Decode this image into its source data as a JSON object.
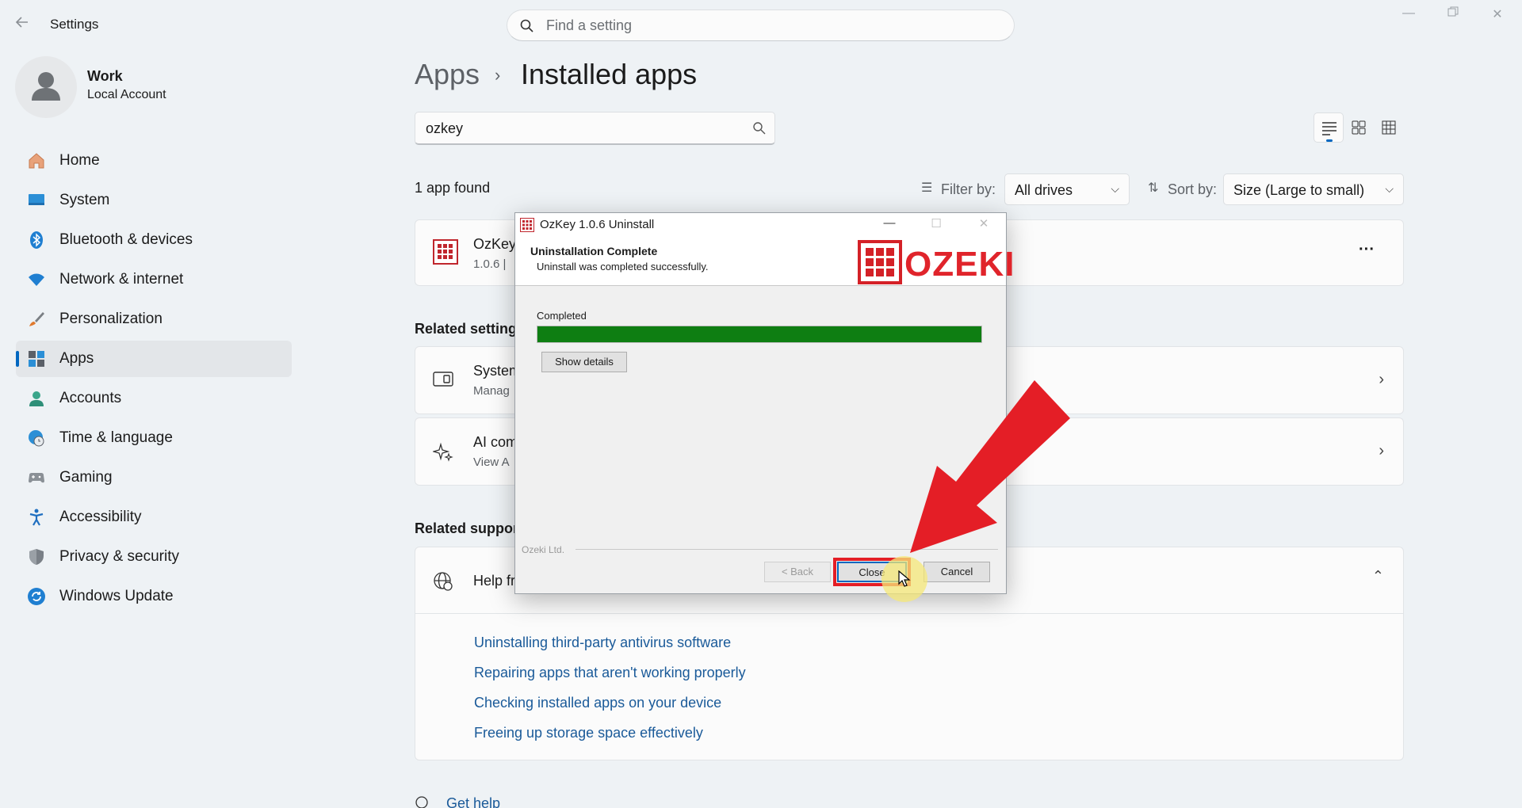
{
  "window": {
    "app_title": "Settings",
    "search_placeholder": "Find a setting"
  },
  "profile": {
    "name": "Work",
    "account_type": "Local Account"
  },
  "sidebar": {
    "items": [
      {
        "label": "Home",
        "icon": "home-icon"
      },
      {
        "label": "System",
        "icon": "system-icon"
      },
      {
        "label": "Bluetooth & devices",
        "icon": "bluetooth-icon"
      },
      {
        "label": "Network & internet",
        "icon": "wifi-icon"
      },
      {
        "label": "Personalization",
        "icon": "brush-icon"
      },
      {
        "label": "Apps",
        "icon": "apps-icon"
      },
      {
        "label": "Accounts",
        "icon": "accounts-icon"
      },
      {
        "label": "Time & language",
        "icon": "clock-globe-icon"
      },
      {
        "label": "Gaming",
        "icon": "gamepad-icon"
      },
      {
        "label": "Accessibility",
        "icon": "accessibility-icon"
      },
      {
        "label": "Privacy & security",
        "icon": "shield-icon"
      },
      {
        "label": "Windows Update",
        "icon": "update-icon"
      }
    ],
    "active_index": 5
  },
  "main": {
    "breadcrumb_parent": "Apps",
    "breadcrumb_separator": "›",
    "title": "Installed apps",
    "app_search_value": "ozkey",
    "result_count": "1 app found",
    "filter_label": "Filter by:",
    "filter_value": "All drives",
    "sort_label": "Sort by:",
    "sort_value": "Size (Large to small)",
    "app_row": {
      "name": "OzKey",
      "version": "1.0.6  |",
      "more_label": "···"
    },
    "related_settings_heading": "Related setting",
    "related_settings": [
      {
        "title": "System",
        "subtitle": "Manag",
        "icon": "system-components-icon"
      },
      {
        "title": "AI com",
        "subtitle": "View A",
        "icon": "sparkle-icon"
      }
    ],
    "related_support_heading": "Related suppor",
    "help_card_title": "Help fr",
    "help_links": [
      "Uninstalling third-party antivirus software",
      "Repairing apps that aren't working properly",
      "Checking installed apps on your device",
      "Freeing up storage space effectively"
    ],
    "get_help": "Get help"
  },
  "dialog": {
    "title": "OzKey 1.0.6 Uninstall",
    "header_title": "Uninstallation Complete",
    "header_subtitle": "Uninstall was completed successfully.",
    "logo_text": "OZEKI",
    "status": "Completed",
    "progress": 1.0,
    "show_details": "Show details",
    "brand": "Ozeki Ltd.",
    "back_button": "< Back",
    "close_button": "Close",
    "cancel_button": "Cancel"
  },
  "colors": {
    "accent": "#0067c0",
    "progress_fill": "#0e7e12",
    "annotation_red": "#e41e26",
    "link": "#1a5a99"
  }
}
